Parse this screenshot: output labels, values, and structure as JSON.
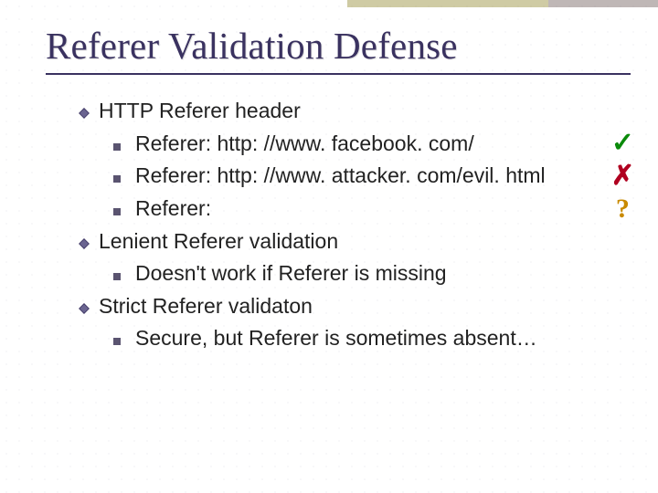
{
  "title": "Referer Validation Defense",
  "bullets": {
    "b1": "HTTP Referer header",
    "b1_1": "Referer: http: //www. facebook. com/",
    "b1_2": "Referer: http: //www. attacker. com/evil. html",
    "b1_3": "Referer:",
    "b2": "Lenient Referer validation",
    "b2_1": "Doesn't work if Referer is missing",
    "b3": "Strict Referer validaton",
    "b3_1": "Secure, but Referer is sometimes absent…"
  },
  "marks": {
    "ok": "✓",
    "bad": "✗",
    "unknown": "?"
  }
}
